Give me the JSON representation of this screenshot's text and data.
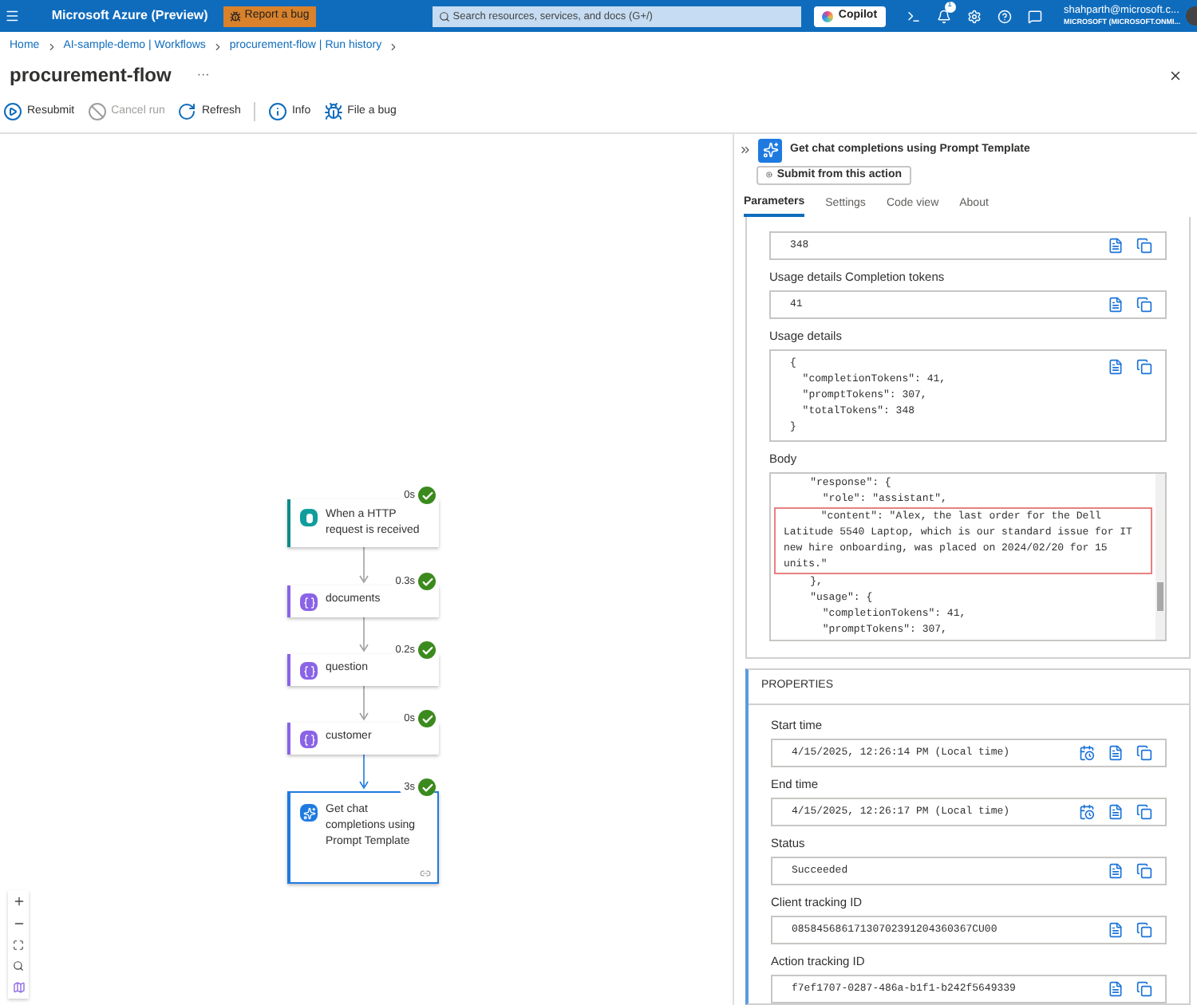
{
  "header": {
    "brand": "Microsoft Azure (Preview)",
    "report_bug": "Report a bug",
    "search_placeholder": "Search resources, services, and docs (G+/)",
    "copilot": "Copilot",
    "notification_count": "1",
    "user_name": "shahparth@microsoft.c...",
    "user_org": "MICROSOFT (MICROSOFT.ONMI..."
  },
  "breadcrumb": [
    "Home",
    "AI-sample-demo | Workflows",
    "procurement-flow | Run history"
  ],
  "page": {
    "title": "procurement-flow",
    "more": "···"
  },
  "toolbar": [
    {
      "kind": "resubmit",
      "label": "Resubmit",
      "disabled": false
    },
    {
      "kind": "cancel",
      "label": "Cancel run",
      "disabled": true
    },
    {
      "kind": "refresh",
      "label": "Refresh",
      "disabled": false
    },
    {
      "kind": "info",
      "label": "Info",
      "disabled": false
    },
    {
      "kind": "bug",
      "label": "File a bug",
      "disabled": false
    }
  ],
  "flow": [
    {
      "kind": "trigger",
      "label": "When a HTTP request is received",
      "duration": "0s",
      "selected": false
    },
    {
      "kind": "variable",
      "label": "documents",
      "duration": "0.3s",
      "selected": false
    },
    {
      "kind": "variable",
      "label": "question",
      "duration": "0.2s",
      "selected": false
    },
    {
      "kind": "variable",
      "label": "customer",
      "duration": "0s",
      "selected": false
    },
    {
      "kind": "ai",
      "label": "Get chat completions using Prompt Template",
      "duration": "3s",
      "selected": true
    }
  ],
  "panel": {
    "title": "Get chat completions using Prompt Template",
    "submit": "Submit from this action",
    "tabs": [
      {
        "label": "Parameters",
        "selected": true
      },
      {
        "label": "Settings",
        "selected": false
      },
      {
        "label": "Code view",
        "selected": false
      },
      {
        "label": "About",
        "selected": false
      }
    ],
    "parameters": [
      {
        "value": "348"
      },
      {
        "label": "Usage details Completion tokens",
        "value": "41"
      },
      {
        "label": "Usage details",
        "lines": [
          "{",
          "  \"completionTokens\": 41,",
          "  \"promptTokens\": 307,",
          "  \"totalTokens\": 348",
          "}"
        ]
      }
    ],
    "body": {
      "label": "Body",
      "lines": [
        {
          "text": "    \"response\": {",
          "highlighted": false
        },
        {
          "text": "      \"role\": \"assistant\",",
          "highlighted": false
        },
        {
          "text": "      \"content\": \"Alex, the last order for the Dell",
          "highlighted": true
        },
        {
          "text": "Latitude 5540 Laptop, which is our standard issue for IT",
          "highlighted": true
        },
        {
          "text": "new hire onboarding, was placed on 2024/02/20 for 15",
          "highlighted": true
        },
        {
          "text": "units.\"",
          "highlighted": true
        },
        {
          "text": "    },",
          "highlighted": false
        },
        {
          "text": "    \"usage\": {",
          "highlighted": false
        },
        {
          "text": "      \"completionTokens\": 41,",
          "highlighted": false
        },
        {
          "text": "      \"promptTokens\": 307,",
          "highlighted": false
        }
      ]
    },
    "properties_title": "PROPERTIES",
    "properties": [
      {
        "label": "Start time",
        "value": "4/15/2025, 12:26:14 PM (Local time)",
        "kind": "time"
      },
      {
        "label": "End time",
        "value": "4/15/2025, 12:26:17 PM (Local time)",
        "kind": "time"
      },
      {
        "label": "Status",
        "value": "Succeeded",
        "kind": "text"
      },
      {
        "label": "Client tracking ID",
        "value": "08584568617130702391204360367CU00",
        "kind": "text"
      },
      {
        "label": "Action tracking ID",
        "value": "f7ef1707-0287-486a-b1f1-b242f5649339",
        "kind": "text"
      }
    ]
  }
}
